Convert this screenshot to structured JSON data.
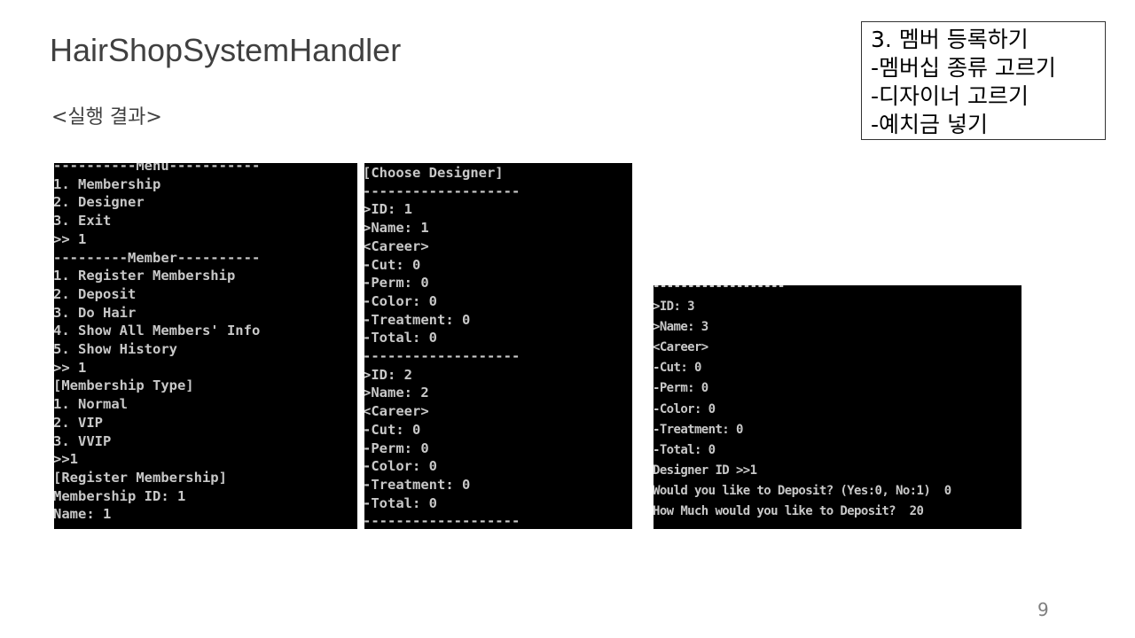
{
  "slide": {
    "title": "HairShopSystemHandler",
    "subtitle": "<실행 결과>",
    "page_number": "9"
  },
  "note": {
    "lines": [
      "3. 멤버 등록하기",
      "-멤버십 종류 고르기",
      "-디자이너 고르기",
      "-예치금 넣기"
    ]
  },
  "console_1": {
    "lines": [
      "----------Menu-----------",
      "1. Membership",
      "2. Designer",
      "3. Exit",
      ">> 1",
      "---------Member----------",
      "1. Register Membership",
      "2. Deposit",
      "3. Do Hair",
      "4. Show All Members' Info",
      "5. Show History",
      ">> 1",
      "[Membership Type]",
      "1. Normal",
      "2. VIP",
      "3. VVIP",
      ">>1",
      "[Register Membership]",
      "Membership ID: 1",
      "Name: 1"
    ]
  },
  "console_2": {
    "lines": [
      "[Choose Designer]",
      "-------------------",
      ">ID: 1",
      ">Name: 1",
      "<Career>",
      "-Cut: 0",
      "-Perm: 0",
      "-Color: 0",
      "-Treatment: 0",
      "-Total: 0",
      "-------------------",
      ">ID: 2",
      ">Name: 2",
      "<Career>",
      "-Cut: 0",
      "-Perm: 0",
      "-Color: 0",
      "-Treatment: 0",
      "-Total: 0",
      "-------------------"
    ]
  },
  "console_3": {
    "lines": [
      "-------------------",
      ">ID: 3",
      ">Name: 3",
      "<Career>",
      "-Cut: 0",
      "-Perm: 0",
      "-Color: 0",
      "-Treatment: 0",
      "-Total: 0",
      "Designer ID >>1",
      "Would you like to Deposit? (Yes:0, No:1)  0",
      "How Much would you like to Deposit?  20"
    ]
  }
}
